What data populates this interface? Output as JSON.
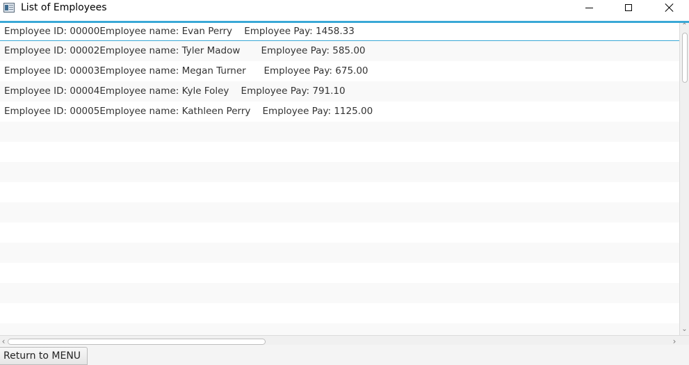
{
  "window": {
    "title": "List of Employees",
    "icon": "app-window-icon"
  },
  "employees": [
    "Employee ID: 00000Employee name: Evan Perry    Employee Pay: 1458.33",
    "Employee ID: 00002Employee name: Tyler Madow       Employee Pay: 585.00",
    "Employee ID: 00003Employee name: Megan Turner      Employee Pay: 675.00",
    "Employee ID: 00004Employee name: Kyle Foley    Employee Pay: 791.10",
    "Employee ID: 00005Employee name: Kathleen Perry    Employee Pay: 1125.00"
  ],
  "selected_index": 0,
  "footer": {
    "return_label": "Return to MENU"
  },
  "colors": {
    "selection_accent": "#39a8d6",
    "row_alt": "#f9f9f9"
  }
}
